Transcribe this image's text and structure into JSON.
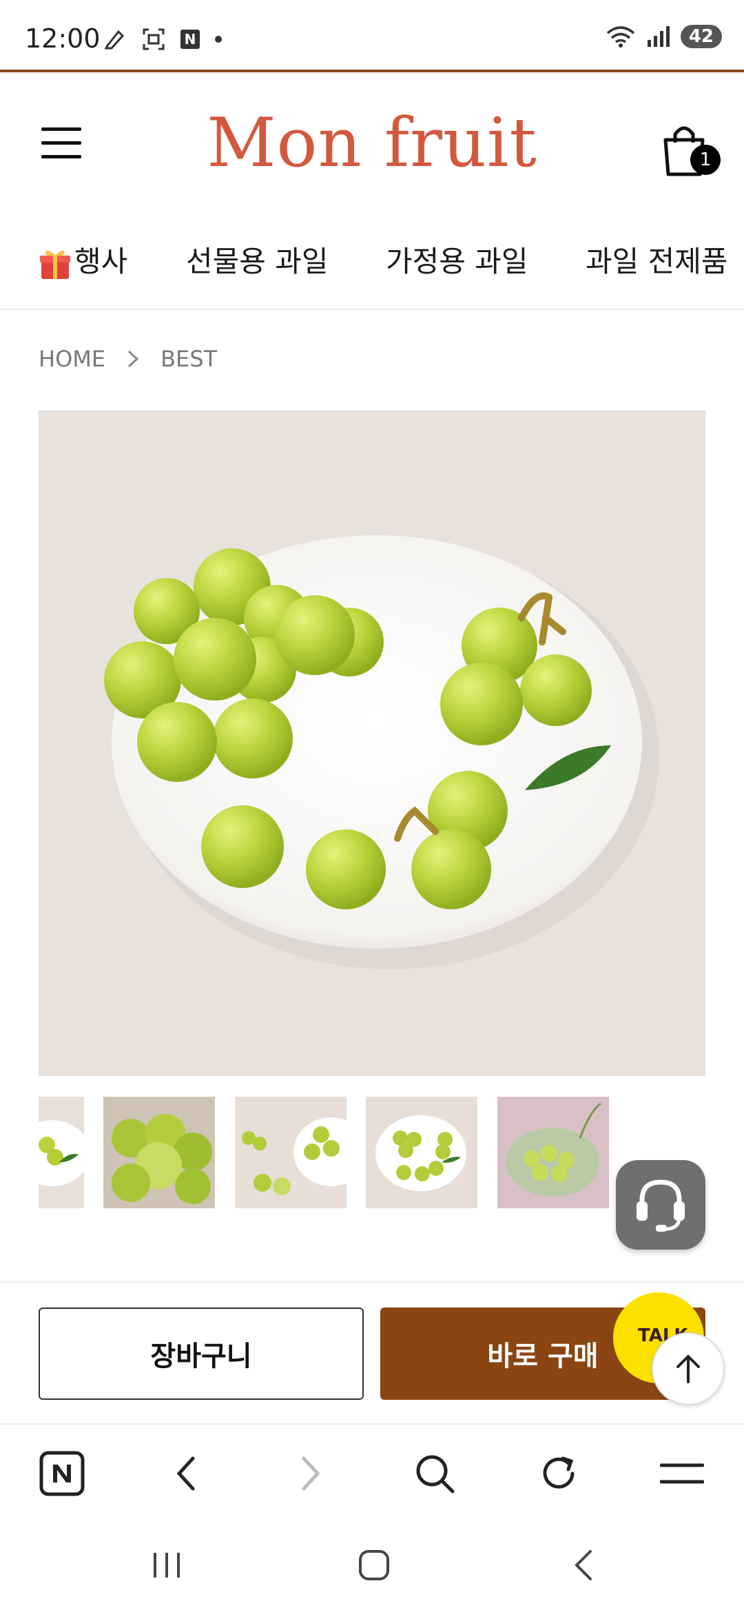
{
  "status_bar": {
    "time": "12:00",
    "battery": "42"
  },
  "header": {
    "logo": "Mon fruit",
    "cart_count": "1"
  },
  "categories": [
    {
      "label": "행사",
      "icon": "gift-icon"
    },
    {
      "label": "선물용 과일"
    },
    {
      "label": "가정용 과일"
    },
    {
      "label": "과일 전제품"
    }
  ],
  "breadcrumb": {
    "home": "HOME",
    "current": "BEST"
  },
  "thumbnails_count": 5,
  "actions": {
    "cart_label": "장바구니",
    "buy_label": "바로 구매",
    "talk_label": "TALK"
  },
  "colors": {
    "brand": "#d3583e",
    "buy_button": "#8b4513",
    "talk": "#fbe000",
    "status_rule": "#8a4a1d"
  }
}
